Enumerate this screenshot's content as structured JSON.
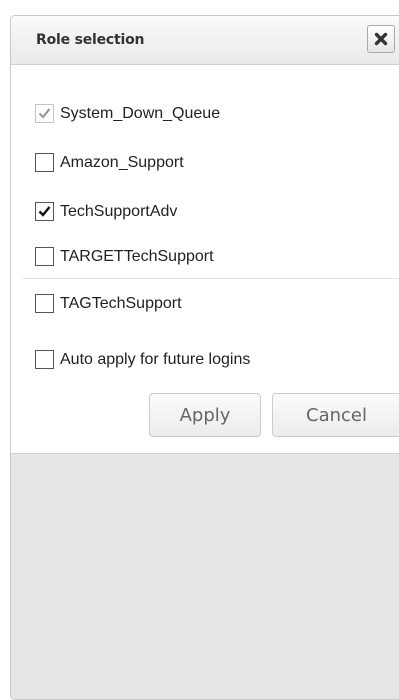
{
  "dialog": {
    "title": "Role selection",
    "close_icon": "close-x-icon"
  },
  "roles": [
    {
      "label": "System_Down_Queue",
      "checked": true,
      "disabled": true
    },
    {
      "label": "Amazon_Support",
      "checked": false,
      "disabled": false
    },
    {
      "label": "TechSupportAdv",
      "checked": true,
      "disabled": false
    },
    {
      "label": "TARGETTechSupport",
      "checked": false,
      "disabled": false
    },
    {
      "label": "TAGTechSupport",
      "checked": false,
      "disabled": false
    }
  ],
  "auto_apply": {
    "label": "Auto apply for future logins",
    "checked": false
  },
  "buttons": {
    "apply_label": "Apply",
    "cancel_label": "Cancel"
  },
  "colors": {
    "check_enabled": "#111111",
    "check_disabled": "#9a9a9a",
    "button_text": "#666666"
  }
}
